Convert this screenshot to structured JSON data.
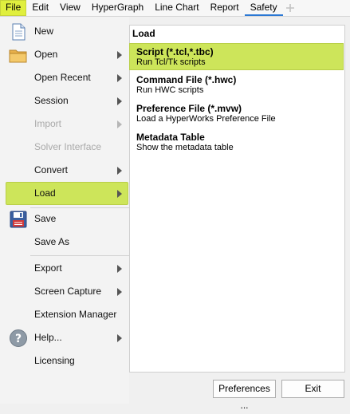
{
  "menubar": {
    "items": [
      {
        "label": "File"
      },
      {
        "label": "Edit"
      },
      {
        "label": "View"
      },
      {
        "label": "HyperGraph"
      },
      {
        "label": "Line Chart"
      },
      {
        "label": "Report"
      },
      {
        "label": "Safety"
      }
    ],
    "add_tab_icon": "plus-icon"
  },
  "leftmenu": {
    "items": [
      {
        "label": "New",
        "icon": "document-icon"
      },
      {
        "label": "Open",
        "icon": "folder-icon"
      },
      {
        "label": "Open Recent"
      },
      {
        "label": "Session"
      },
      {
        "label": "Import"
      },
      {
        "label": "Solver Interface"
      },
      {
        "label": "Convert"
      },
      {
        "label": "Load"
      },
      {
        "label": "Save",
        "icon": "floppy-icon"
      },
      {
        "label": "Save As"
      },
      {
        "label": "Export"
      },
      {
        "label": "Screen Capture"
      },
      {
        "label": "Extension Manager"
      },
      {
        "label": "Help...",
        "icon": "help-icon"
      },
      {
        "label": "Licensing"
      }
    ]
  },
  "panel": {
    "title": "Load",
    "entries": [
      {
        "title": "Script (*.tcl,*.tbc)",
        "desc": "Run Tcl/Tk scripts"
      },
      {
        "title": "Command File (*.hwc)",
        "desc": "Run HWC scripts"
      },
      {
        "title": "Preference File (*.mvw)",
        "desc": "Load a HyperWorks Preference File"
      },
      {
        "title": "Metadata Table",
        "desc": "Show the metadata table"
      }
    ]
  },
  "buttons": {
    "preferences": "Preferences ...",
    "exit": "Exit"
  },
  "colors": {
    "highlight": "#cde55a",
    "active_menu": "#e0ef3e",
    "selected_tab_underline": "#2b78d4"
  }
}
